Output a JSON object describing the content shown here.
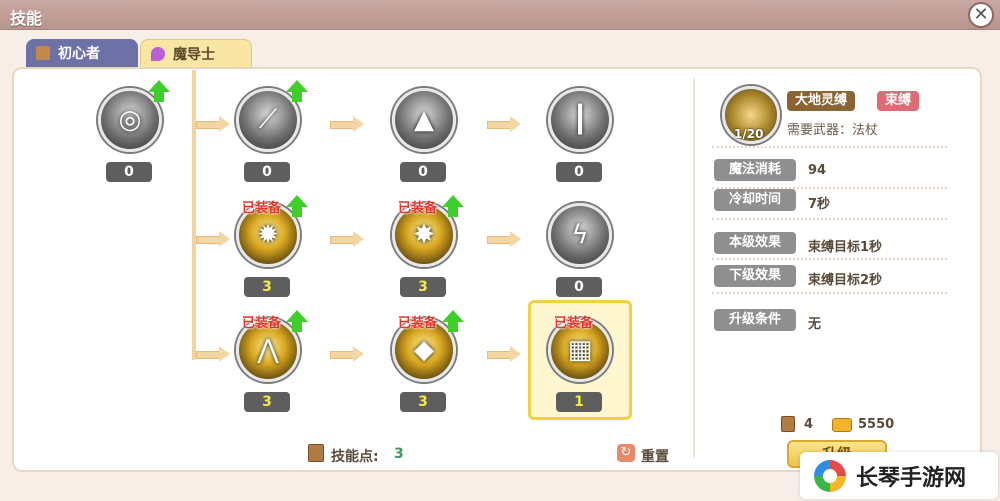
{
  "window": {
    "title": "技能",
    "close_label": "✕"
  },
  "tabs": [
    {
      "label": "初心者",
      "active": false
    },
    {
      "label": "魔导士",
      "active": true
    }
  ],
  "skills": [
    {
      "id": "r1c1",
      "level": "0",
      "equipped": false,
      "upgradable": true,
      "icon": "orb-icon",
      "yellow": false,
      "gold": false
    },
    {
      "id": "r1c2",
      "level": "0",
      "equipped": false,
      "upgradable": true,
      "icon": "blade-icon",
      "yellow": false,
      "gold": false
    },
    {
      "id": "r1c3",
      "level": "0",
      "equipped": false,
      "upgradable": false,
      "icon": "drop-icon",
      "yellow": false,
      "gold": false
    },
    {
      "id": "r1c4",
      "level": "0",
      "equipped": false,
      "upgradable": false,
      "icon": "beam-icon",
      "yellow": false,
      "gold": false
    },
    {
      "id": "r2c1",
      "level": "3",
      "equipped": true,
      "upgradable": true,
      "icon": "sun-icon",
      "yellow": true,
      "gold": true
    },
    {
      "id": "r2c2",
      "level": "3",
      "equipped": true,
      "upgradable": true,
      "icon": "burst-icon",
      "yellow": true,
      "gold": true
    },
    {
      "id": "r2c3",
      "level": "0",
      "equipped": false,
      "upgradable": false,
      "icon": "lightning-icon",
      "yellow": false,
      "gold": false
    },
    {
      "id": "r3c1",
      "level": "3",
      "equipped": true,
      "upgradable": true,
      "icon": "spikes-icon",
      "yellow": true,
      "gold": true
    },
    {
      "id": "r3c2",
      "level": "3",
      "equipped": true,
      "upgradable": true,
      "icon": "crystal-icon",
      "yellow": true,
      "gold": true
    },
    {
      "id": "r3c3",
      "level": "1",
      "equipped": true,
      "upgradable": false,
      "icon": "bind-icon",
      "yellow": true,
      "gold": true,
      "selected": true
    }
  ],
  "equipped_label": "已装备",
  "footer": {
    "skill_points_label": "技能点:",
    "skill_points_value": "3",
    "reset_label": "重置"
  },
  "detail": {
    "name": "大地灵缚",
    "type": "束缚",
    "level": "1/20",
    "weapon_req": "需要武器：法杖",
    "attributes": [
      {
        "label": "魔法消耗",
        "value": "94"
      },
      {
        "label": "冷却时间",
        "value": "7秒"
      },
      {
        "label": "本级效果",
        "value": "束缚目标1秒"
      },
      {
        "label": "下级效果",
        "value": "束缚目标2秒"
      },
      {
        "label": "升级条件",
        "value": "无"
      }
    ],
    "cost_books": "4",
    "cost_gold": "5550",
    "upgrade_label": "升级"
  },
  "watermark": {
    "text": "长琴手游网"
  },
  "colors": {
    "accent_gold": "#f4cf45",
    "title_bar": "#b9958f",
    "equipped_red": "#e0352a",
    "level_yellow": "#f5e74a"
  }
}
